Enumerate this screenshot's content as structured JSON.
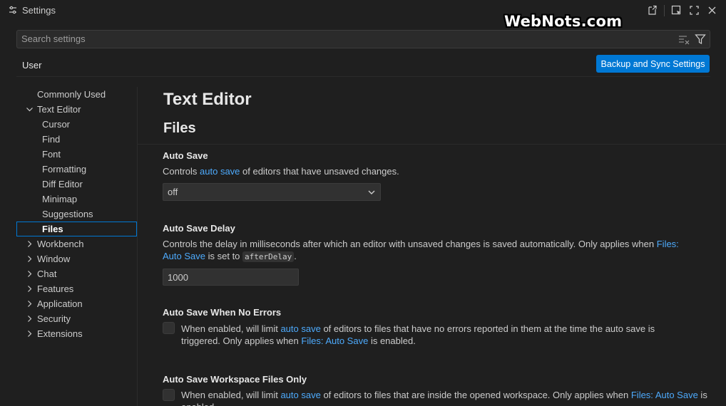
{
  "window": {
    "title": "Settings"
  },
  "watermark": "WebNots.com",
  "search": {
    "placeholder": "Search settings"
  },
  "tabs": {
    "user": "User"
  },
  "sync_button": "Backup and Sync Settings",
  "toc": [
    {
      "label": "Commonly Used",
      "indent": 0,
      "chevron": "none"
    },
    {
      "label": "Text Editor",
      "indent": 0,
      "chevron": "down"
    },
    {
      "label": "Cursor",
      "indent": 1,
      "chevron": "none"
    },
    {
      "label": "Find",
      "indent": 1,
      "chevron": "none"
    },
    {
      "label": "Font",
      "indent": 1,
      "chevron": "none"
    },
    {
      "label": "Formatting",
      "indent": 1,
      "chevron": "none"
    },
    {
      "label": "Diff Editor",
      "indent": 1,
      "chevron": "none"
    },
    {
      "label": "Minimap",
      "indent": 1,
      "chevron": "none"
    },
    {
      "label": "Suggestions",
      "indent": 1,
      "chevron": "none"
    },
    {
      "label": "Files",
      "indent": 1,
      "chevron": "none",
      "selected": true
    },
    {
      "label": "Workbench",
      "indent": 0,
      "chevron": "right"
    },
    {
      "label": "Window",
      "indent": 0,
      "chevron": "right"
    },
    {
      "label": "Chat",
      "indent": 0,
      "chevron": "right"
    },
    {
      "label": "Features",
      "indent": 0,
      "chevron": "right"
    },
    {
      "label": "Application",
      "indent": 0,
      "chevron": "right"
    },
    {
      "label": "Security",
      "indent": 0,
      "chevron": "right"
    },
    {
      "label": "Extensions",
      "indent": 0,
      "chevron": "right"
    }
  ],
  "content": {
    "section": "Text Editor",
    "subsection": "Files",
    "auto_save": {
      "title": "Auto Save",
      "desc_pre": "Controls ",
      "desc_link": "auto save",
      "desc_post": " of editors that have unsaved changes.",
      "value": "off"
    },
    "auto_save_delay": {
      "title": "Auto Save Delay",
      "desc_pre": "Controls the delay in milliseconds after which an editor with unsaved changes is saved automatically. Only applies when ",
      "desc_link": "Files: Auto Save",
      "desc_mid": " is set to ",
      "desc_code": "afterDelay",
      "desc_post": ".",
      "value": "1000"
    },
    "auto_save_no_errors": {
      "title": "Auto Save When No Errors",
      "desc_pre": "When enabled, will limit ",
      "desc_link1": "auto save",
      "desc_mid": " of editors to files that have no errors reported in them at the time the auto save is triggered. Only applies when ",
      "desc_link2": "Files: Auto Save",
      "desc_post": " is enabled.",
      "checked": false
    },
    "auto_save_workspace": {
      "title": "Auto Save Workspace Files Only",
      "desc_pre": "When enabled, will limit ",
      "desc_link1": "auto save",
      "desc_mid": " of editors to files that are inside the opened workspace. Only applies when ",
      "desc_link2": "Files: Auto Save",
      "desc_post": " is enabled.",
      "checked": false
    }
  }
}
